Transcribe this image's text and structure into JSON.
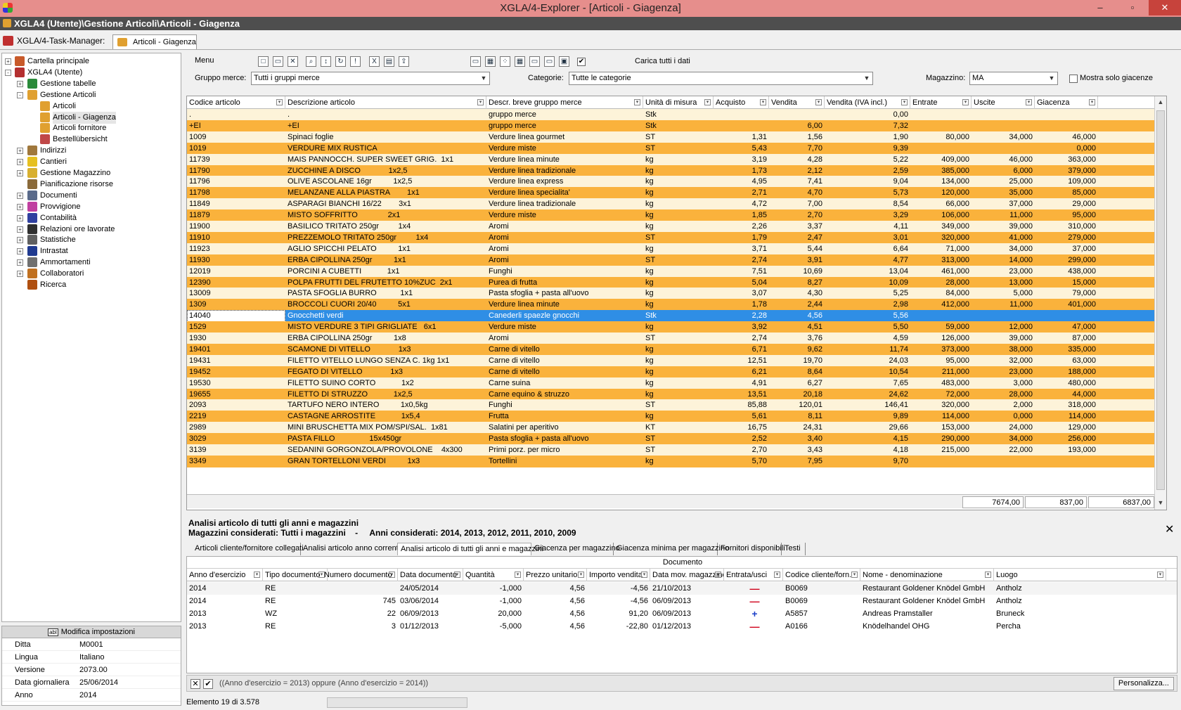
{
  "window": {
    "title": "XGLA/4-Explorer - [Articoli - Giagenza]",
    "path": "XGLA4 (Utente)\\Gestione Articoli\\Articoli - Giagenza",
    "task_manager": "XGLA/4-Task-Manager:",
    "active_tab": "Articoli - Giagenza",
    "minimize": "–",
    "maximize": "▫",
    "close": "✕"
  },
  "tree": [
    {
      "label": "Cartella principale",
      "indent": 0,
      "exp": "+",
      "icon": "folder-globe-icon",
      "color": "#c85a2a"
    },
    {
      "label": "XGLA4 (Utente)",
      "indent": 0,
      "exp": "-",
      "icon": "user-icon",
      "color": "#b43030"
    },
    {
      "label": "Gestione tabelle",
      "indent": 1,
      "exp": "+",
      "icon": "book-icon",
      "color": "#2a8a3a"
    },
    {
      "label": "Gestione Articoli",
      "indent": 1,
      "exp": "-",
      "icon": "box-icon",
      "color": "#e0a030"
    },
    {
      "label": "Articoli",
      "indent": 2,
      "exp": "",
      "icon": "box-icon",
      "color": "#e0a030"
    },
    {
      "label": "Articoli - Giagenza",
      "indent": 2,
      "exp": "",
      "icon": "box-icon",
      "color": "#e0a030",
      "selected": true
    },
    {
      "label": "Articoli fornitore",
      "indent": 2,
      "exp": "",
      "icon": "box-icon",
      "color": "#e0a030"
    },
    {
      "label": "Bestellübersicht",
      "indent": 2,
      "exp": "",
      "icon": "list-icon",
      "color": "#c04848"
    },
    {
      "label": "Indirizzi",
      "indent": 1,
      "exp": "+",
      "icon": "address-book-icon",
      "color": "#a0783c"
    },
    {
      "label": "Cantieri",
      "indent": 1,
      "exp": "+",
      "icon": "helmet-icon",
      "color": "#e6c020"
    },
    {
      "label": "Gestione Magazzino",
      "indent": 1,
      "exp": "+",
      "icon": "warehouse-icon",
      "color": "#d8b030"
    },
    {
      "label": "Pianificazione risorse",
      "indent": 1,
      "exp": "",
      "icon": "calendar-icon",
      "color": "#8a6a3a"
    },
    {
      "label": "Documenti",
      "indent": 1,
      "exp": "+",
      "icon": "document-icon",
      "color": "#5a6a8a"
    },
    {
      "label": "Provvigione",
      "indent": 1,
      "exp": "+",
      "icon": "coin-icon",
      "color": "#c040a0"
    },
    {
      "label": "Contabilità",
      "indent": 1,
      "exp": "+",
      "icon": "ledger-icon",
      "color": "#3040a0"
    },
    {
      "label": "Relazioni ore lavorate",
      "indent": 1,
      "exp": "+",
      "icon": "clock-icon",
      "color": "#303030"
    },
    {
      "label": "Statistiche",
      "indent": 1,
      "exp": "+",
      "icon": "chart-icon",
      "color": "#606060"
    },
    {
      "label": "Intrastat",
      "indent": 1,
      "exp": "+",
      "icon": "eu-flag-icon",
      "color": "#203a90"
    },
    {
      "label": "Ammortamenti",
      "indent": 1,
      "exp": "+",
      "icon": "calculator-icon",
      "color": "#707070"
    },
    {
      "label": "Collaboratori",
      "indent": 1,
      "exp": "+",
      "icon": "people-icon",
      "color": "#c07020"
    },
    {
      "label": "Ricerca",
      "indent": 1,
      "exp": "",
      "icon": "search-icon",
      "color": "#b05010"
    }
  ],
  "settings": {
    "header": "Modifica impostazioni",
    "badge": "abl",
    "rows": [
      {
        "k": "Ditta",
        "v": "M0001"
      },
      {
        "k": "Lingua",
        "v": "Italiano"
      },
      {
        "k": "Versione",
        "v": "2073.00"
      },
      {
        "k": "Data giornaliera",
        "v": "25/06/2014"
      },
      {
        "k": "Anno",
        "v": "2014"
      }
    ]
  },
  "toolbar": {
    "menu": "Menu",
    "carica_label": "Carica tutti i dati",
    "carica_checked": "✔",
    "gruppo_label": "Gruppo merce:",
    "gruppo_value": "Tutti i gruppi merce",
    "categorie_label": "Categorie:",
    "categorie_value": "Tutte le categorie",
    "magazzino_label": "Magazzino:",
    "magazzino_value": "MA",
    "mostra_label": "Mostra solo giacenze"
  },
  "grid": {
    "columns": [
      "Codice articolo",
      "Descrizione articolo",
      "Descr. breve gruppo merce",
      "Unità di misura",
      "Acquisto",
      "Vendita",
      "Vendita (IVA incl.)",
      "Entrate",
      "Uscite",
      "Giacenza"
    ],
    "rows": [
      [
        ".",
        ".",
        "gruppo merce",
        "Stk",
        "",
        "",
        "0,00",
        "",
        "",
        ""
      ],
      [
        "+EI",
        "+EI",
        "gruppo merce",
        "Stk",
        "",
        "6,00",
        "7,32",
        "",
        "",
        ""
      ],
      [
        "1009",
        "Spinaci foglie",
        "Verdure linea gourmet",
        "ST",
        "1,31",
        "1,56",
        "1,90",
        "80,000",
        "34,000",
        "46,000"
      ],
      [
        "1019",
        "VERDURE MIX RUSTICA",
        "Verdure miste",
        "ST",
        "5,43",
        "7,70",
        "9,39",
        "",
        "",
        "0,000"
      ],
      [
        "11739",
        "MAIS PANNOCCH. SUPER SWEET GRIG.  1x1",
        "Verdure linea minute",
        "kg",
        "3,19",
        "4,28",
        "5,22",
        "409,000",
        "46,000",
        "363,000"
      ],
      [
        "11790",
        "ZUCCHINE A DISCO             1x2,5",
        "Verdure linea tradizionale",
        "kg",
        "1,73",
        "2,12",
        "2,59",
        "385,000",
        "6,000",
        "379,000"
      ],
      [
        "11796",
        "OLIVE ASCOLANE 16gr          1x2,5",
        "Verdure linea express",
        "kg",
        "4,95",
        "7,41",
        "9,04",
        "134,000",
        "25,000",
        "109,000"
      ],
      [
        "11798",
        "MELANZANE ALLA PIASTRA        1x1",
        "Verdure linea specialita'",
        "kg",
        "2,71",
        "4,70",
        "5,73",
        "120,000",
        "35,000",
        "85,000"
      ],
      [
        "11849",
        "ASPARAGI BIANCHI 16/22        3x1",
        "Verdure linea tradizionale",
        "kg",
        "4,72",
        "7,00",
        "8,54",
        "66,000",
        "37,000",
        "29,000"
      ],
      [
        "11879",
        "MISTO SOFFRITTO              2x1",
        "Verdure miste",
        "kg",
        "1,85",
        "2,70",
        "3,29",
        "106,000",
        "11,000",
        "95,000"
      ],
      [
        "11900",
        "BASILICO TRITATO 250gr         1x4",
        "Aromi",
        "kg",
        "2,26",
        "3,37",
        "4,11",
        "349,000",
        "39,000",
        "310,000"
      ],
      [
        "11910",
        "PREZZEMOLO TRITATO 250gr         1x4",
        "Aromi",
        "ST",
        "1,79",
        "2,47",
        "3,01",
        "320,000",
        "41,000",
        "279,000"
      ],
      [
        "11923",
        "AGLIO SPICCHI PELATO          1x1",
        "Aromi",
        "kg",
        "3,71",
        "5,44",
        "6,64",
        "71,000",
        "34,000",
        "37,000"
      ],
      [
        "11930",
        "ERBA CIPOLLINA 250gr          1x1",
        "Aromi",
        "ST",
        "2,74",
        "3,91",
        "4,77",
        "313,000",
        "14,000",
        "299,000"
      ],
      [
        "12019",
        "PORCINI A CUBETTI            1x1",
        "Funghi",
        "kg",
        "7,51",
        "10,69",
        "13,04",
        "461,000",
        "23,000",
        "438,000"
      ],
      [
        "12390",
        "POLPA FRUTTI DEL FRUTETTO 10%ZUC  2x1",
        "Purea di frutta",
        "kg",
        "5,04",
        "8,27",
        "10,09",
        "28,000",
        "13,000",
        "15,000"
      ],
      [
        "13009",
        "PASTA SFOGLIA BURRO           1x1",
        "Pasta sfoglia + pasta all'uovo",
        "kg",
        "3,07",
        "4,30",
        "5,25",
        "84,000",
        "5,000",
        "79,000"
      ],
      [
        "1309",
        "BROCCOLI CUORI 20/40          5x1",
        "Verdure linea minute",
        "kg",
        "1,78",
        "2,44",
        "2,98",
        "412,000",
        "11,000",
        "401,000"
      ],
      [
        "14040",
        "Gnocchetti verdi",
        "Canederli spaezle gnocchi",
        "Stk",
        "2,28",
        "4,56",
        "5,56",
        "",
        "",
        ""
      ],
      [
        "1529",
        "MISTO VERDURE 3 TIPI GRIGLIATE   6x1",
        "Verdure miste",
        "kg",
        "3,92",
        "4,51",
        "5,50",
        "59,000",
        "12,000",
        "47,000"
      ],
      [
        "1930",
        "ERBA CIPOLLINA 250gr          1x8",
        "Aromi",
        "ST",
        "2,74",
        "3,76",
        "4,59",
        "126,000",
        "39,000",
        "87,000"
      ],
      [
        "19401",
        "SCAMONE DI VITELLO             1x3",
        "Carne di vitello",
        "kg",
        "6,71",
        "9,62",
        "11,74",
        "373,000",
        "38,000",
        "335,000"
      ],
      [
        "19431",
        "FILETTO VITELLO LUNGO SENZA C. 1kg 1x1",
        "Carne di vitello",
        "kg",
        "12,51",
        "19,70",
        "24,03",
        "95,000",
        "32,000",
        "63,000"
      ],
      [
        "19452",
        "FEGATO DI VITELLO             1x3",
        "Carne di vitello",
        "kg",
        "6,21",
        "8,64",
        "10,54",
        "211,000",
        "23,000",
        "188,000"
      ],
      [
        "19530",
        "FILETTO SUINO CORTO            1x2",
        "Carne suina",
        "kg",
        "4,91",
        "6,27",
        "7,65",
        "483,000",
        "3,000",
        "480,000"
      ],
      [
        "19655",
        "FILETTO DI STRUZZO            1x2,5",
        "Carne equino & struzzo",
        "kg",
        "13,51",
        "20,18",
        "24,62",
        "72,000",
        "28,000",
        "44,000"
      ],
      [
        "2093",
        "TARTUFO NERO INTERO          1x0,5kg",
        "Funghi",
        "ST",
        "85,88",
        "120,01",
        "146,41",
        "320,000",
        "2,000",
        "318,000"
      ],
      [
        "2219",
        "CASTAGNE ARROSTITE            1x5,4",
        "Frutta",
        "kg",
        "5,61",
        "8,11",
        "9,89",
        "114,000",
        "0,000",
        "114,000"
      ],
      [
        "2989",
        "MINI BRUSCHETTA MIX POM/SPI/SAL.  1x81",
        "Salatini per aperitivo",
        "KT",
        "16,75",
        "24,31",
        "29,66",
        "153,000",
        "24,000",
        "129,000"
      ],
      [
        "3029",
        "PASTA FILLO                15x450gr",
        "Pasta sfoglia + pasta all'uovo",
        "ST",
        "2,52",
        "3,40",
        "4,15",
        "290,000",
        "34,000",
        "256,000"
      ],
      [
        "3139",
        "SEDANINI GORGONZOLA/PROVOLONE    4x300",
        "Primi porz. per micro",
        "ST",
        "2,70",
        "3,43",
        "4,18",
        "215,000",
        "22,000",
        "193,000"
      ],
      [
        "3349",
        "GRAN TORTELLONI VERDI          1x3",
        "Tortellini",
        "kg",
        "5,70",
        "7,95",
        "9,70",
        "",
        "",
        ""
      ]
    ],
    "selected_index": 18,
    "totals": {
      "entrate": "7674,00",
      "uscite": "837,00",
      "giacenza": "6837,00"
    }
  },
  "analysis": {
    "title": "Analisi articolo di tutti gli anni e magazzini",
    "subtitle": "Magazzini considerati: Tutti i magazzini    -     Anni considerati: 2014, 2013, 2012, 2011, 2010, 2009",
    "tabs": [
      "Articoli cliente/fornitore collegati",
      "Analisi articolo anno corrente",
      "Analisi articolo di tutti gli anni e magazzini",
      "Giacenza per magazzino",
      "Giacenza minima per magazzino",
      "Fornitori disponibili",
      "Testi"
    ],
    "active_tab": 2,
    "group_header": "Documento",
    "columns": [
      "Anno d'esercizio",
      "Tipo documento",
      "Numero documento",
      "Data documento",
      "Quantità",
      "Prezzo unitario",
      "Importo vendita",
      "Data mov. magazzino",
      "Entrata/usci",
      "Codice cliente/forn.",
      "Nome - denominazione",
      "Luogo"
    ],
    "rows": [
      [
        "2014",
        "RE",
        "",
        "24/05/2014",
        "-1,000",
        "4,56",
        "-4,56",
        "21/10/2013",
        "minus",
        "B0069",
        "Restaurant Goldener Knödel GmbH",
        "Antholz"
      ],
      [
        "2014",
        "RE",
        "745",
        "03/06/2014",
        "-1,000",
        "4,56",
        "-4,56",
        "06/09/2013",
        "minus",
        "B0069",
        "Restaurant Goldener Knödel GmbH",
        "Antholz"
      ],
      [
        "2013",
        "WZ",
        "22",
        "06/09/2013",
        "20,000",
        "4,56",
        "91,20",
        "06/09/2013",
        "plus",
        "A5857",
        "Andreas Pramstaller",
        "Bruneck"
      ],
      [
        "2013",
        "RE",
        "3",
        "01/12/2013",
        "-5,000",
        "4,56",
        "-22,80",
        "01/12/2013",
        "minus",
        "A0166",
        "Knödelhandel OHG",
        "Percha"
      ]
    ],
    "filter_text": "((Anno d'esercizio = 2013) oppure (Anno d'esercizio = 2014))",
    "personalizza": "Personalizza...",
    "close": "✕"
  },
  "status": {
    "text": "Elemento 19 di 3.578"
  }
}
